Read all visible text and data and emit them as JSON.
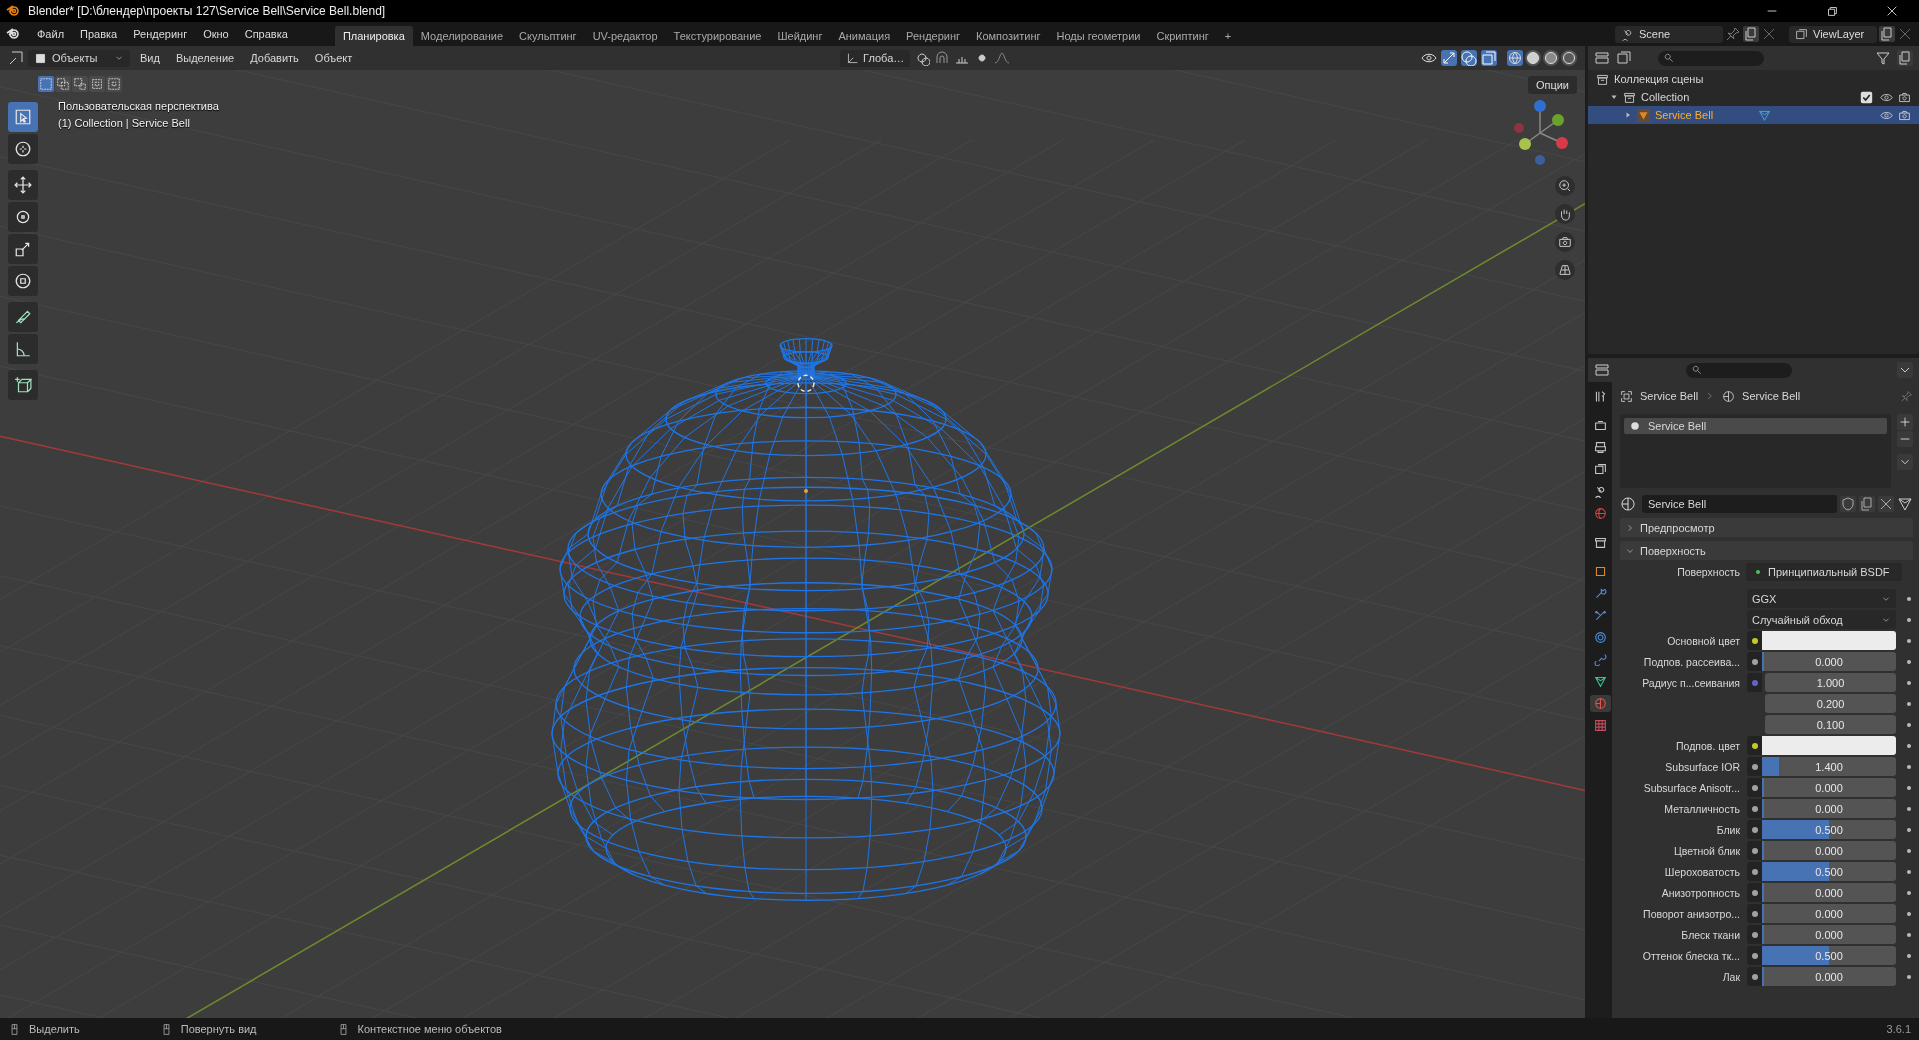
{
  "window": {
    "title": "Blender* [D:\\блендер\\проекты 127\\Service Bell\\Service Bell.blend]"
  },
  "menu": [
    "Файл",
    "Правка",
    "Рендеринг",
    "Окно",
    "Справка"
  ],
  "workspaces": [
    {
      "label": "Планировка",
      "selected": true
    },
    {
      "label": "Моделирование",
      "selected": false
    },
    {
      "label": "Скульптинг",
      "selected": false
    },
    {
      "label": "UV-редактор",
      "selected": false
    },
    {
      "label": "Текстурирование",
      "selected": false
    },
    {
      "label": "Шейдинг",
      "selected": false
    },
    {
      "label": "Анимация",
      "selected": false
    },
    {
      "label": "Рендеринг",
      "selected": false
    },
    {
      "label": "Композитинг",
      "selected": false
    },
    {
      "label": "Ноды геометрии",
      "selected": false
    },
    {
      "label": "Скриптинг",
      "selected": false
    }
  ],
  "add_workspace": "+",
  "scene": "Scene",
  "view_layer": "ViewLayer",
  "viewport_header": {
    "mode": "Объекты",
    "menus": [
      "Вид",
      "Выделение",
      "Добавить",
      "Объект"
    ],
    "orientation": "Глоба…"
  },
  "select_modes": [
    {
      "kind": "set",
      "selected": true
    },
    {
      "kind": "extend",
      "selected": false
    },
    {
      "kind": "subtract",
      "selected": false
    },
    {
      "kind": "invert",
      "selected": false
    },
    {
      "kind": "intersect",
      "selected": false
    }
  ],
  "shading": [
    {
      "kind": "wireframe",
      "selected": true
    },
    {
      "kind": "solid",
      "selected": false
    },
    {
      "kind": "material",
      "selected": false
    },
    {
      "kind": "rendered",
      "selected": false
    }
  ],
  "options_button": "Опции",
  "viewport": {
    "view_name": "Пользовательская перспектива",
    "object_info": "(1) Collection | Service Bell"
  },
  "toolbar": [
    {
      "kind": "select",
      "selected": true
    },
    {
      "kind": "cursor",
      "selected": false
    },
    {
      "kind": "move",
      "selected": false
    },
    {
      "kind": "rotate",
      "selected": false
    },
    {
      "kind": "scale",
      "selected": false
    },
    {
      "kind": "transform",
      "selected": false
    },
    {
      "kind": "annotate",
      "selected": false
    },
    {
      "kind": "measure",
      "selected": false
    },
    {
      "kind": "add-cube",
      "selected": false
    }
  ],
  "outliner": {
    "items": [
      {
        "label": "Коллекция сцены",
        "children": [
          {
            "label": "Collection",
            "expanded": true,
            "checked": true,
            "selected": false,
            "children": [
              {
                "label": "Service Bell",
                "expanded": false,
                "selected": true
              }
            ]
          }
        ]
      }
    ]
  },
  "property_tabs": [
    {
      "kind": "tool",
      "selected": false
    },
    {
      "kind": "render",
      "selected": false
    },
    {
      "kind": "output",
      "selected": false
    },
    {
      "kind": "view-layer",
      "selected": false
    },
    {
      "kind": "scene",
      "selected": false
    },
    {
      "kind": "world",
      "selected": false
    },
    {
      "kind": "collection",
      "selected": false
    },
    {
      "kind": "object",
      "selected": false
    },
    {
      "kind": "modifier",
      "selected": false
    },
    {
      "kind": "particles",
      "selected": false
    },
    {
      "kind": "physics",
      "selected": false
    },
    {
      "kind": "constraints",
      "selected": false
    },
    {
      "kind": "data",
      "selected": false
    },
    {
      "kind": "material",
      "selected": true
    },
    {
      "kind": "texture",
      "selected": false
    }
  ],
  "properties": {
    "breadcrumb": [
      "Service Bell",
      "Service Bell"
    ],
    "material_slots": [
      {
        "label": "Service Bell",
        "selected": true
      }
    ],
    "material_name": "Service Bell",
    "panels": [
      {
        "label": "Предпросмотр",
        "expanded": false
      },
      {
        "label": "Поверхность",
        "expanded": true
      }
    ],
    "surface_label": "Поверхность",
    "shader": "Принципиальный BSDF",
    "rows": [
      {
        "kind": "dropdown",
        "value": "GGX"
      },
      {
        "kind": "dropdown",
        "value": "Случайный обход"
      },
      {
        "kind": "color",
        "label": "Основной цвет",
        "color": "#c7c729"
      },
      {
        "kind": "slider",
        "label": "Подпов. рассеива...",
        "color": "#a1a1a1",
        "value": "0.000",
        "level": 0
      },
      {
        "kind": "vector",
        "label": "Радиус п...сеивания",
        "color": "#6363c7",
        "values": [
          "1.000",
          "0.200",
          "0.100"
        ]
      },
      {
        "kind": "color",
        "label": "Подпов. цвет",
        "color": "#c7c729"
      },
      {
        "kind": "slider",
        "label": "Subsurface IOR",
        "color": "#a1a1a1",
        "value": "1.400",
        "level": 0.13
      },
      {
        "kind": "slider",
        "label": "Subsurface Anisotr...",
        "color": "#a1a1a1",
        "value": "0.000",
        "level": 0
      },
      {
        "kind": "slider",
        "label": "Металличность",
        "color": "#a1a1a1",
        "value": "0.000",
        "level": 0
      },
      {
        "kind": "slider",
        "label": "Блик",
        "color": "#a1a1a1",
        "value": "0.500",
        "level": 0.5
      },
      {
        "kind": "slider",
        "label": "Цветной блик",
        "color": "#a1a1a1",
        "value": "0.000",
        "level": 0
      },
      {
        "kind": "slider",
        "label": "Шероховатость",
        "color": "#a1a1a1",
        "value": "0.500",
        "level": 0.5
      },
      {
        "kind": "slider",
        "label": "Анизотропность",
        "color": "#a1a1a1",
        "value": "0.000",
        "level": 0
      },
      {
        "kind": "slider",
        "label": "Поворот анизотро...",
        "color": "#a1a1a1",
        "value": "0.000",
        "level": 0
      },
      {
        "kind": "slider",
        "label": "Блеск ткани",
        "color": "#a1a1a1",
        "value": "0.000",
        "level": 0
      },
      {
        "kind": "slider",
        "label": "Оттенок блеска тк...",
        "color": "#a1a1a1",
        "value": "0.500",
        "level": 0.5
      },
      {
        "kind": "slider",
        "label": "Лак",
        "color": "#a1a1a1",
        "value": "0.000",
        "level": 0
      }
    ]
  },
  "status_bar": {
    "hints": [
      "Выделить",
      "Повернуть вид",
      "Контекстное меню объектов"
    ],
    "version": "3.6.1"
  }
}
